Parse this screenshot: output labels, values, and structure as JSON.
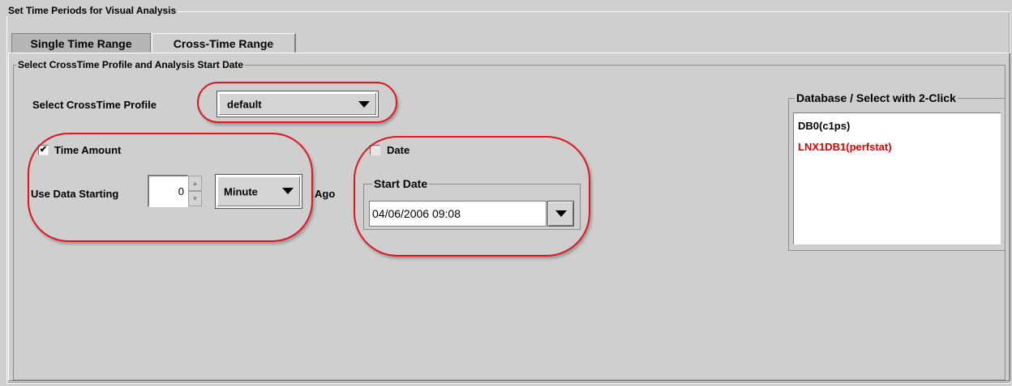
{
  "window": {
    "title": "Set Time Periods for Visual Analysis"
  },
  "tabs": [
    {
      "label": "Single Time Range",
      "selected": false
    },
    {
      "label": "Cross-Time Range",
      "selected": true
    }
  ],
  "profile_group": {
    "title": "Select CrossTime Profile and Analysis Start Date",
    "profile_label": "Select CrossTime Profile",
    "profile_value": "default"
  },
  "time_amount": {
    "checkbox_label": "Time Amount",
    "checked": true,
    "use_data_label": "Use Data Starting",
    "spinner_value": "0",
    "unit_value": "Minute",
    "ago_label": "Ago"
  },
  "date": {
    "checkbox_label": "Date",
    "checked": false,
    "start_date_title": "Start Date",
    "start_date_value": "04/06/2006 09:08"
  },
  "database": {
    "title": "Database / Select with 2-Click",
    "items": [
      {
        "label": "DB0(c1ps)",
        "color": "#000000"
      },
      {
        "label": "LNX1DB1(perfstat)",
        "color": "#e00000"
      }
    ]
  },
  "colors": {
    "background": "#cfcfcf",
    "annotation_red": "#e0141c",
    "highlight_item": "#e00000"
  },
  "icons": {
    "combo_arrow": "triangle-down-icon",
    "spinner_up": "spin-up-icon",
    "spinner_down": "spin-down-icon",
    "checkmark": "check-icon"
  }
}
